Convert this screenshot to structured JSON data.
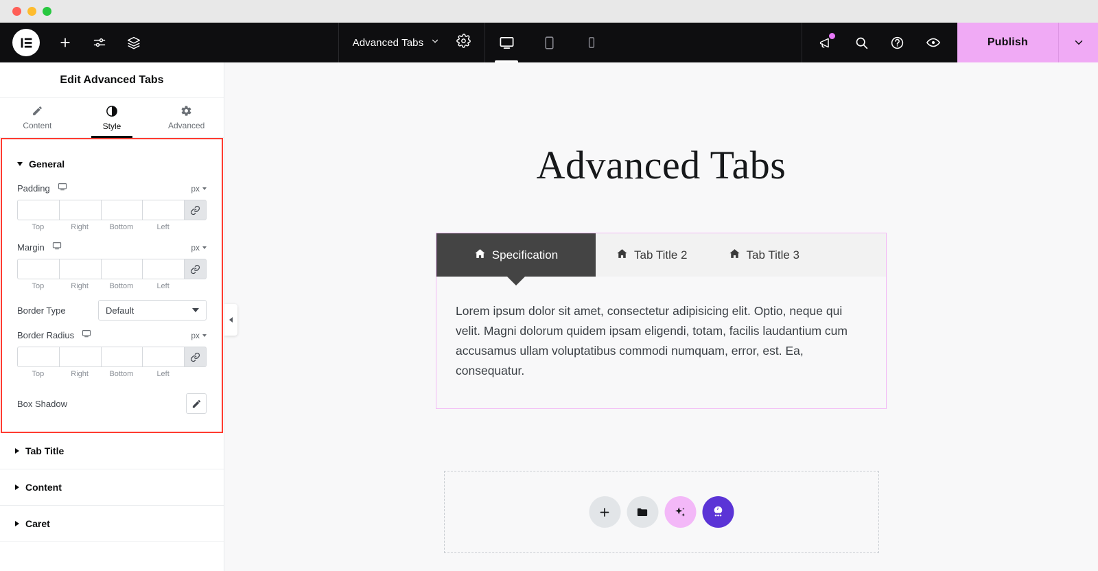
{
  "window": {
    "traffic_lights": [
      "close",
      "minimize",
      "maximize"
    ]
  },
  "toolbar": {
    "logo_icon": "elementor-logo-icon",
    "left_icons": [
      {
        "name": "add-element-icon",
        "glyph": "plus"
      },
      {
        "name": "site-settings-icon",
        "glyph": "sliders"
      },
      {
        "name": "structure-layers-icon",
        "glyph": "layers"
      }
    ],
    "document_name": "Advanced Tabs",
    "document_caret_icon": "chevron-down-icon",
    "settings_icon": "gear-icon",
    "responsive": [
      {
        "name": "desktop",
        "icon": "desktop-icon",
        "active": true
      },
      {
        "name": "tablet",
        "icon": "tablet-icon",
        "active": false
      },
      {
        "name": "mobile",
        "icon": "mobile-icon",
        "active": false
      }
    ],
    "right_icons": [
      {
        "name": "notifications-icon",
        "glyph": "megaphone",
        "badge": true
      },
      {
        "name": "finder-search-icon",
        "glyph": "magnifier"
      },
      {
        "name": "help-icon",
        "glyph": "question-circle"
      },
      {
        "name": "preview-icon",
        "glyph": "eye"
      }
    ],
    "publish_label": "Publish",
    "publish_caret_icon": "chevron-down-icon",
    "publish_color": "#f0aaf5"
  },
  "panel": {
    "title": "Edit Advanced Tabs",
    "tabs": [
      {
        "label": "Content",
        "icon": "pencil-icon",
        "active": false
      },
      {
        "label": "Style",
        "icon": "contrast-circle-icon",
        "active": true
      },
      {
        "label": "Advanced",
        "icon": "gear-icon",
        "active": false
      }
    ],
    "highlight_color": "#ff3b30",
    "general": {
      "title": "General",
      "padding": {
        "label": "Padding",
        "device_icon": "desktop-icon",
        "unit": "px",
        "values": [
          "",
          "",
          "",
          ""
        ],
        "sides": [
          "Top",
          "Right",
          "Bottom",
          "Left"
        ],
        "link_icon": "link-icon"
      },
      "margin": {
        "label": "Margin",
        "device_icon": "desktop-icon",
        "unit": "px",
        "values": [
          "",
          "",
          "",
          ""
        ],
        "sides": [
          "Top",
          "Right",
          "Bottom",
          "Left"
        ],
        "link_icon": "link-icon"
      },
      "border_type": {
        "label": "Border Type",
        "value": "Default",
        "caret_icon": "caret-down-icon"
      },
      "border_radius": {
        "label": "Border Radius",
        "device_icon": "desktop-icon",
        "unit": "px",
        "values": [
          "",
          "",
          "",
          ""
        ],
        "sides": [
          "Top",
          "Right",
          "Bottom",
          "Left"
        ],
        "link_icon": "link-icon"
      },
      "box_shadow": {
        "label": "Box Shadow",
        "edit_icon": "pencil-icon"
      }
    },
    "collapsed_sections": [
      {
        "label": "Tab Title"
      },
      {
        "label": "Content"
      },
      {
        "label": "Caret"
      }
    ]
  },
  "canvas": {
    "collapse_handle_icon": "chevron-left-icon",
    "heading": "Advanced Tabs",
    "widget": {
      "border_color": "#f2b9f5",
      "active_tab_color": "#444444",
      "tabs": [
        {
          "label": "Specification",
          "icon": "home-icon",
          "active": true
        },
        {
          "label": "Tab Title 2",
          "icon": "home-icon",
          "active": false
        },
        {
          "label": "Tab Title 3",
          "icon": "home-icon",
          "active": false
        }
      ],
      "panel_text": "Lorem ipsum dolor sit amet, consectetur adipisicing elit. Optio, neque qui velit. Magni dolorum quidem ipsam eligendi, totam, facilis laudantium cum accusamus ullam voluptatibus commodi numquam, error, est. Ea, consequatur."
    },
    "drop_zone": {
      "buttons": [
        {
          "name": "add-section-button",
          "icon": "plus-icon",
          "style": "grey"
        },
        {
          "name": "add-template-button",
          "icon": "folder-icon",
          "style": "grey"
        },
        {
          "name": "ai-generate-button",
          "icon": "sparkle-icon",
          "style": "pink"
        },
        {
          "name": "container-grid-button",
          "icon": "elementor-ai-icon",
          "style": "purple"
        }
      ]
    }
  }
}
